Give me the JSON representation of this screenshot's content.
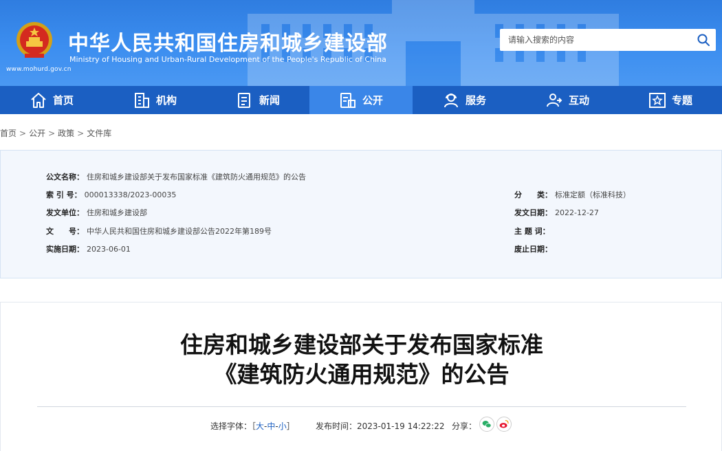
{
  "header": {
    "title": "中华人民共和国住房和城乡建设部",
    "subtitle": "Ministry of Housing and Urban-Rural Development of the People's Republic of China",
    "url": "www.mohurd.gov.cn",
    "search_placeholder": "请输入搜索的内容"
  },
  "nav": {
    "items": [
      {
        "label": "首页",
        "icon": "home-icon"
      },
      {
        "label": "机构",
        "icon": "building-icon"
      },
      {
        "label": "新闻",
        "icon": "news-icon"
      },
      {
        "label": "公开",
        "icon": "document-icon"
      },
      {
        "label": "服务",
        "icon": "service-icon"
      },
      {
        "label": "互动",
        "icon": "interaction-icon"
      },
      {
        "label": "专题",
        "icon": "star-icon"
      }
    ],
    "active_index": 3
  },
  "breadcrumb": [
    "首页",
    "公开",
    "政策",
    "文件库"
  ],
  "meta": {
    "doc_name_label": "公文名称：",
    "doc_name": "住房和城乡建设部关于发布国家标准《建筑防火通用规范》的公告",
    "index_label": "索 引 号：",
    "index": "000013338/2023-00035",
    "category_label": "分　　类：",
    "category": "标准定额（标准科技）",
    "issuer_label": "发文单位：",
    "issuer": "住房和城乡建设部",
    "issue_date_label": "发文日期：",
    "issue_date": "2022-12-27",
    "doc_no_label": "文　　号：",
    "doc_no": "中华人民共和国住房和城乡建设部公告2022年第189号",
    "subject_label": "主 题 词：",
    "subject": "",
    "effective_label": "实施日期：",
    "effective": "2023-06-01",
    "repeal_label": "废止日期：",
    "repeal": ""
  },
  "article": {
    "title_line1": "住房和城乡建设部关于发布国家标准",
    "title_line2": "《建筑防火通用规范》的公告",
    "font_label": "选择字体：",
    "font_open": "［",
    "font_large": "大",
    "font_medium": "中",
    "font_small": "小",
    "font_close": "］",
    "font_sep": "-",
    "publish_label": "发布时间：",
    "publish_time": "2023-01-19 14:22:22",
    "share_label": "分享："
  },
  "colors": {
    "header_blue": "#3c8ef0",
    "nav_blue": "#1b5fc2",
    "nav_active": "#3a86e8",
    "wechat_green": "#2aae67",
    "weibo_red": "#e6162d"
  }
}
